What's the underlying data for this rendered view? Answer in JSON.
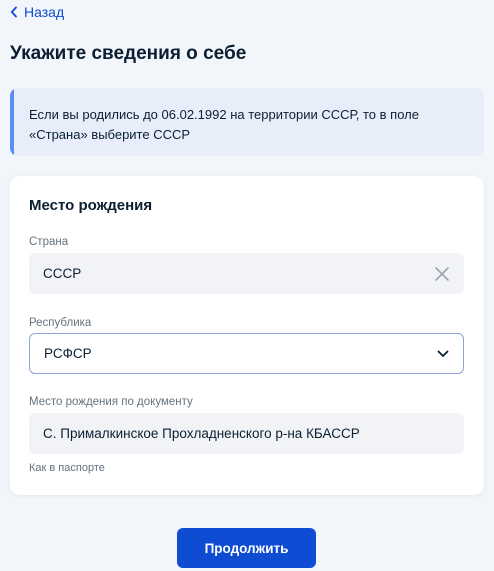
{
  "nav": {
    "back_label": "Назад"
  },
  "page": {
    "title": "Укажите сведения о себе"
  },
  "info": {
    "text_line1": "Если вы родились до 06.02.1992 на территории СССР, то в поле",
    "text_line2": "«Страна» выберите СССР"
  },
  "birthplace": {
    "section_title": "Место рождения",
    "country": {
      "label": "Страна",
      "value": "СССР",
      "clear_icon": "close-icon"
    },
    "republic": {
      "label": "Республика",
      "value": "РСФСР",
      "dropdown_icon": "chevron-down-icon"
    },
    "document_place": {
      "label": "Место рождения по документу",
      "value": "С. Прималкинское Прохладненского р-на КБАССР",
      "hint": "Как в паспорте"
    }
  },
  "actions": {
    "continue_label": "Продолжить"
  },
  "colors": {
    "accent": "#0d4cd3",
    "info_background": "#e8eef9",
    "info_bar": "#5b8def",
    "page_background": "#f2f5fa"
  }
}
